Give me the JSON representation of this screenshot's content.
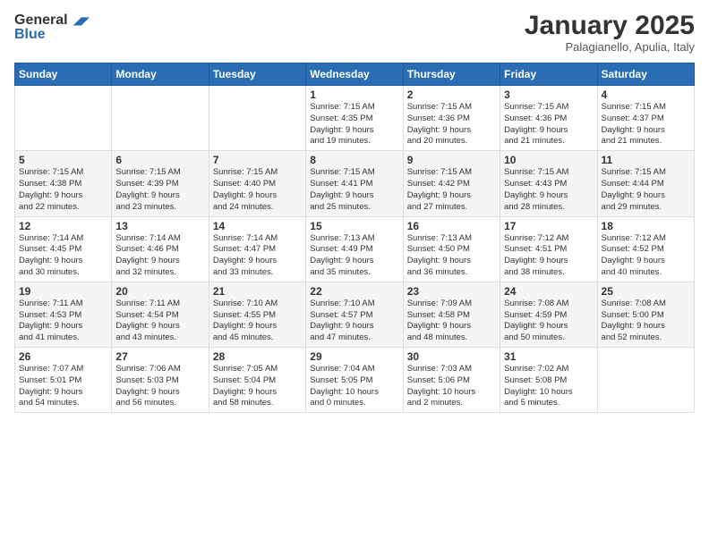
{
  "header": {
    "logo_general": "General",
    "logo_blue": "Blue",
    "month": "January 2025",
    "location": "Palagianello, Apulia, Italy"
  },
  "days_of_week": [
    "Sunday",
    "Monday",
    "Tuesday",
    "Wednesday",
    "Thursday",
    "Friday",
    "Saturday"
  ],
  "weeks": [
    [
      {
        "day": "",
        "info": ""
      },
      {
        "day": "",
        "info": ""
      },
      {
        "day": "",
        "info": ""
      },
      {
        "day": "1",
        "info": "Sunrise: 7:15 AM\nSunset: 4:35 PM\nDaylight: 9 hours\nand 19 minutes."
      },
      {
        "day": "2",
        "info": "Sunrise: 7:15 AM\nSunset: 4:36 PM\nDaylight: 9 hours\nand 20 minutes."
      },
      {
        "day": "3",
        "info": "Sunrise: 7:15 AM\nSunset: 4:36 PM\nDaylight: 9 hours\nand 21 minutes."
      },
      {
        "day": "4",
        "info": "Sunrise: 7:15 AM\nSunset: 4:37 PM\nDaylight: 9 hours\nand 21 minutes."
      }
    ],
    [
      {
        "day": "5",
        "info": "Sunrise: 7:15 AM\nSunset: 4:38 PM\nDaylight: 9 hours\nand 22 minutes."
      },
      {
        "day": "6",
        "info": "Sunrise: 7:15 AM\nSunset: 4:39 PM\nDaylight: 9 hours\nand 23 minutes."
      },
      {
        "day": "7",
        "info": "Sunrise: 7:15 AM\nSunset: 4:40 PM\nDaylight: 9 hours\nand 24 minutes."
      },
      {
        "day": "8",
        "info": "Sunrise: 7:15 AM\nSunset: 4:41 PM\nDaylight: 9 hours\nand 25 minutes."
      },
      {
        "day": "9",
        "info": "Sunrise: 7:15 AM\nSunset: 4:42 PM\nDaylight: 9 hours\nand 27 minutes."
      },
      {
        "day": "10",
        "info": "Sunrise: 7:15 AM\nSunset: 4:43 PM\nDaylight: 9 hours\nand 28 minutes."
      },
      {
        "day": "11",
        "info": "Sunrise: 7:15 AM\nSunset: 4:44 PM\nDaylight: 9 hours\nand 29 minutes."
      }
    ],
    [
      {
        "day": "12",
        "info": "Sunrise: 7:14 AM\nSunset: 4:45 PM\nDaylight: 9 hours\nand 30 minutes."
      },
      {
        "day": "13",
        "info": "Sunrise: 7:14 AM\nSunset: 4:46 PM\nDaylight: 9 hours\nand 32 minutes."
      },
      {
        "day": "14",
        "info": "Sunrise: 7:14 AM\nSunset: 4:47 PM\nDaylight: 9 hours\nand 33 minutes."
      },
      {
        "day": "15",
        "info": "Sunrise: 7:13 AM\nSunset: 4:49 PM\nDaylight: 9 hours\nand 35 minutes."
      },
      {
        "day": "16",
        "info": "Sunrise: 7:13 AM\nSunset: 4:50 PM\nDaylight: 9 hours\nand 36 minutes."
      },
      {
        "day": "17",
        "info": "Sunrise: 7:12 AM\nSunset: 4:51 PM\nDaylight: 9 hours\nand 38 minutes."
      },
      {
        "day": "18",
        "info": "Sunrise: 7:12 AM\nSunset: 4:52 PM\nDaylight: 9 hours\nand 40 minutes."
      }
    ],
    [
      {
        "day": "19",
        "info": "Sunrise: 7:11 AM\nSunset: 4:53 PM\nDaylight: 9 hours\nand 41 minutes."
      },
      {
        "day": "20",
        "info": "Sunrise: 7:11 AM\nSunset: 4:54 PM\nDaylight: 9 hours\nand 43 minutes."
      },
      {
        "day": "21",
        "info": "Sunrise: 7:10 AM\nSunset: 4:55 PM\nDaylight: 9 hours\nand 45 minutes."
      },
      {
        "day": "22",
        "info": "Sunrise: 7:10 AM\nSunset: 4:57 PM\nDaylight: 9 hours\nand 47 minutes."
      },
      {
        "day": "23",
        "info": "Sunrise: 7:09 AM\nSunset: 4:58 PM\nDaylight: 9 hours\nand 48 minutes."
      },
      {
        "day": "24",
        "info": "Sunrise: 7:08 AM\nSunset: 4:59 PM\nDaylight: 9 hours\nand 50 minutes."
      },
      {
        "day": "25",
        "info": "Sunrise: 7:08 AM\nSunset: 5:00 PM\nDaylight: 9 hours\nand 52 minutes."
      }
    ],
    [
      {
        "day": "26",
        "info": "Sunrise: 7:07 AM\nSunset: 5:01 PM\nDaylight: 9 hours\nand 54 minutes."
      },
      {
        "day": "27",
        "info": "Sunrise: 7:06 AM\nSunset: 5:03 PM\nDaylight: 9 hours\nand 56 minutes."
      },
      {
        "day": "28",
        "info": "Sunrise: 7:05 AM\nSunset: 5:04 PM\nDaylight: 9 hours\nand 58 minutes."
      },
      {
        "day": "29",
        "info": "Sunrise: 7:04 AM\nSunset: 5:05 PM\nDaylight: 10 hours\nand 0 minutes."
      },
      {
        "day": "30",
        "info": "Sunrise: 7:03 AM\nSunset: 5:06 PM\nDaylight: 10 hours\nand 2 minutes."
      },
      {
        "day": "31",
        "info": "Sunrise: 7:02 AM\nSunset: 5:08 PM\nDaylight: 10 hours\nand 5 minutes."
      },
      {
        "day": "",
        "info": ""
      }
    ]
  ]
}
